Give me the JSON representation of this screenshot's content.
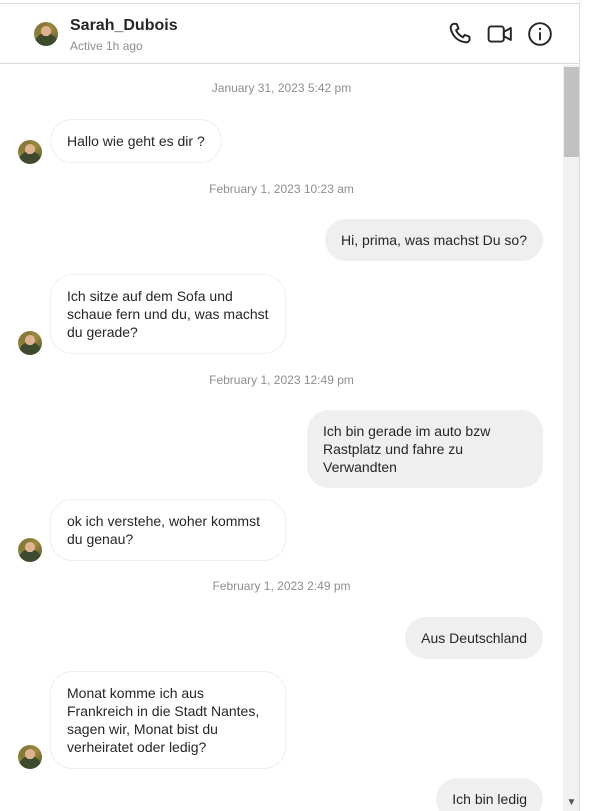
{
  "header": {
    "name": "Sarah_Dubois",
    "status": "Active 1h ago",
    "icons": [
      "phone-icon",
      "video-camera-icon",
      "info-icon"
    ]
  },
  "messages": [
    {
      "type": "timestamp",
      "text": "January 31, 2023 5:42 pm"
    },
    {
      "type": "incoming",
      "text": "Hallo wie geht es dir ?"
    },
    {
      "type": "timestamp",
      "text": "February 1, 2023 10:23 am"
    },
    {
      "type": "outgoing",
      "text": "Hi, prima, was machst Du so?"
    },
    {
      "type": "incoming",
      "text": "Ich sitze auf dem Sofa und\nschaue fern und du, was machst\ndu gerade?"
    },
    {
      "type": "timestamp",
      "text": "February 1, 2023 12:49 pm"
    },
    {
      "type": "outgoing",
      "text": "Ich bin gerade im auto bzw\nRastplatz und fahre zu\nVerwandten"
    },
    {
      "type": "incoming",
      "text": "ok ich verstehe, woher kommst\ndu genau?"
    },
    {
      "type": "timestamp",
      "text": "February 1, 2023 2:49 pm"
    },
    {
      "type": "outgoing",
      "text": "Aus Deutschland"
    },
    {
      "type": "incoming",
      "text": "Monat komme ich aus\nFrankreich in die Stadt Nantes,\nsagen wir, Monat bist du\nverheiratet oder ledig?"
    },
    {
      "type": "outgoing",
      "text": "Ich bin ledig"
    }
  ]
}
